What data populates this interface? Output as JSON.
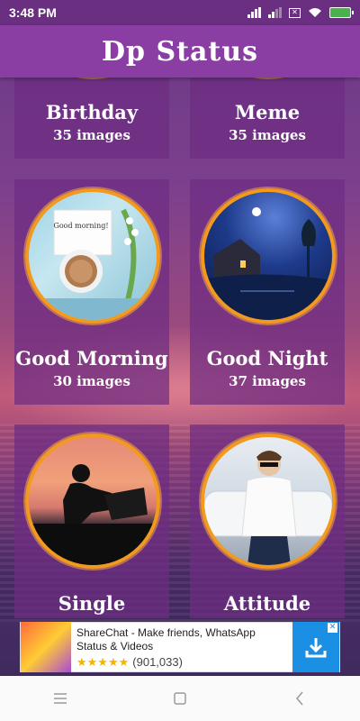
{
  "status_bar": {
    "time": "3:48 PM"
  },
  "app": {
    "title": "Dp Status"
  },
  "categories": [
    {
      "name": "Birthday",
      "count": "35 images"
    },
    {
      "name": "Meme",
      "count": "35 images"
    },
    {
      "name": "Good Morning",
      "count": "30 images",
      "photo_text": "Good morning!"
    },
    {
      "name": "Good Night",
      "count": "37 images"
    },
    {
      "name": "Single",
      "count": ""
    },
    {
      "name": "Attitude",
      "count": ""
    }
  ],
  "ad": {
    "title": "ShareChat - Make friends, WhatsApp Status & Videos",
    "rating_stars": "★★★★★",
    "rating_value": 4.5,
    "review_count": "(901,033)",
    "accent_color": "#1a8fe3"
  },
  "colors": {
    "appbar": "#8a3ea3",
    "card_ring": "#f39a1e",
    "statusbar": "#6a2f80"
  }
}
